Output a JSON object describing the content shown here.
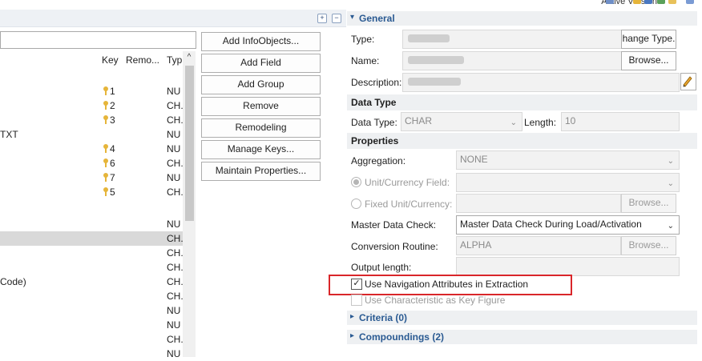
{
  "topbar": {
    "active_version": "Active Version"
  },
  "left": {
    "columns": {
      "key": "Key",
      "remote": "Remo...",
      "type": "Typ"
    },
    "rows": [
      {
        "text": "",
        "key": "1",
        "type": "NU"
      },
      {
        "text": "",
        "key": "2",
        "type": "CH."
      },
      {
        "text": "",
        "key": "3",
        "type": "CH."
      },
      {
        "text": "TXT",
        "key": "",
        "type": "NU"
      },
      {
        "text": "",
        "key": "4",
        "type": "NU"
      },
      {
        "text": "",
        "key": "6",
        "type": "CH."
      },
      {
        "text": "",
        "key": "7",
        "type": "NU"
      },
      {
        "text": "",
        "key": "5",
        "type": "CH."
      },
      {
        "text": "",
        "key": "",
        "type": ""
      },
      {
        "text": "",
        "key": "",
        "type": "NU"
      },
      {
        "text": "",
        "key": "",
        "type": "CH."
      },
      {
        "text": "",
        "key": "",
        "type": "CH."
      },
      {
        "text": "",
        "key": "",
        "type": "CH."
      },
      {
        "text": "Code)",
        "key": "",
        "type": "CH."
      },
      {
        "text": "",
        "key": "",
        "type": "CH."
      },
      {
        "text": "",
        "key": "",
        "type": "NU"
      },
      {
        "text": "",
        "key": "",
        "type": "NU"
      },
      {
        "text": "",
        "key": "",
        "type": "CH."
      },
      {
        "text": "",
        "key": "",
        "type": "NU"
      }
    ]
  },
  "actions": {
    "add_infoobjects": "Add InfoObjects...",
    "add_field": "Add Field",
    "add_group": "Add Group",
    "remove": "Remove",
    "remodeling": "Remodeling",
    "manage_keys": "Manage Keys...",
    "maintain_properties": "Maintain Properties..."
  },
  "general": {
    "title": "General",
    "type_label": "Type:",
    "change_type_btn": "hange Type.",
    "name_label": "Name:",
    "browse_btn": "Browse...",
    "description_label": "Description:"
  },
  "data_type": {
    "title": "Data Type",
    "data_type_label": "Data Type:",
    "data_type_value": "CHAR",
    "length_label": "Length:",
    "length_value": "10"
  },
  "properties": {
    "title": "Properties",
    "aggregation_label": "Aggregation:",
    "aggregation_value": "NONE",
    "unit_field_label": "Unit/Currency Field:",
    "fixed_unit_label": "Fixed Unit/Currency:",
    "browse_btn": "Browse...",
    "master_data_check_label": "Master Data Check:",
    "master_data_check_value": "Master Data Check During Load/Activation",
    "conversion_routine_label": "Conversion Routine:",
    "conversion_routine_value": "ALPHA",
    "output_length_label": "Output length:",
    "use_nav_attr_label": "Use Navigation Attributes in Extraction",
    "use_char_as_kf_label": "Use Characteristic as Key Figure",
    "use_nav_attr_checked": true,
    "use_char_as_kf_checked": false
  },
  "criteria": {
    "title": "Criteria (0)"
  },
  "compoundings": {
    "title": "Compoundings (2)"
  }
}
